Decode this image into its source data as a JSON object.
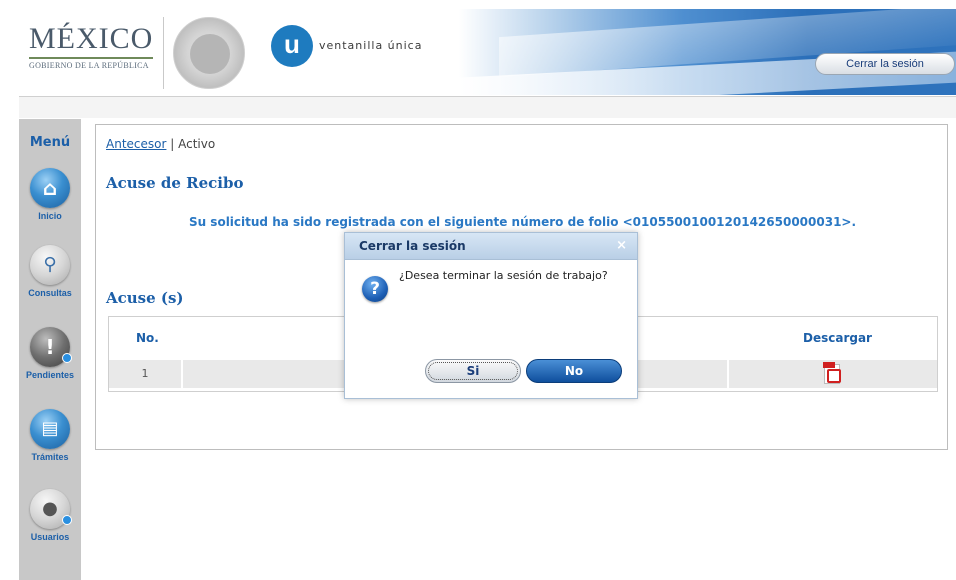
{
  "header": {
    "logo_mexico": "MÉXICO",
    "logo_gobierno": "GOBIERNO DE LA REPÚBLICA",
    "vu_letter": "u",
    "vu_text": "ventanilla única",
    "logout_label": "Cerrar la sesión"
  },
  "sidebar": {
    "title": "Menú",
    "items": [
      {
        "label": "Inicio",
        "icon": "home-icon"
      },
      {
        "label": "Consultas",
        "icon": "search-icon"
      },
      {
        "label": "Pendientes",
        "icon": "alert-icon"
      },
      {
        "label": "Trámites",
        "icon": "document-icon"
      },
      {
        "label": "Usuarios",
        "icon": "users-icon"
      }
    ]
  },
  "main": {
    "breadcrumb": {
      "link": "Antecesor",
      "separator": " | ",
      "current": "Activo"
    },
    "heading": "Acuse de Recibo",
    "message": "Su solicitud ha sido registrada con el siguiente número de folio <0105500100120142650000031>.",
    "acuses_heading": "Acuse (s)",
    "table": {
      "columns": [
        "No.",
        "Descargar"
      ],
      "rows": [
        {
          "no": "1",
          "download_icon": "pdf-icon"
        }
      ]
    }
  },
  "modal": {
    "title": "Cerrar la sesión",
    "close": "×",
    "icon": "question-icon",
    "message": "¿Desea terminar la sesión de trabajo?",
    "yes_label": "Si",
    "no_label": "No"
  },
  "colors": {
    "accent": "#1c5fa8",
    "folio_text": "#2a78c4",
    "sidebar_bg": "#c8c8c8",
    "no_button": "#0f4f9d"
  }
}
